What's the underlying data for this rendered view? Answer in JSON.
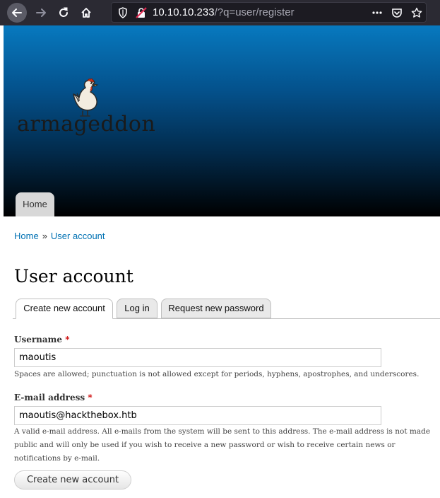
{
  "browser": {
    "url_host": "10.10.10.233",
    "url_path": "/?q=user/register",
    "icons": [
      "back-icon",
      "forward-icon",
      "reload-icon",
      "home-icon",
      "shield-icon",
      "insecure-lock-icon",
      "more-icon",
      "pocket-icon",
      "star-icon"
    ]
  },
  "header": {
    "site_name": "armageddon",
    "nav": {
      "home_label": "Home"
    }
  },
  "breadcrumb": [
    {
      "label": "Home"
    },
    {
      "label": "User account"
    }
  ],
  "breadcrumb_separator": "»",
  "page": {
    "title": "User account",
    "tabs": [
      {
        "label": "Create new account",
        "active": true
      },
      {
        "label": "Log in",
        "active": false
      },
      {
        "label": "Request new password",
        "active": false
      }
    ]
  },
  "form": {
    "username": {
      "label": "Username",
      "required_marker": "*",
      "value": "maoutis",
      "description": "Spaces are allowed; punctuation is not allowed except for periods, hyphens, apostrophes, and underscores."
    },
    "email": {
      "label": "E-mail address",
      "required_marker": "*",
      "value": "maoutis@hackthebox.htb",
      "description": "A valid e-mail address. All e-mails from the system will be sent to this address. The e-mail address is not made public and will only be used if you wish to receive a new password or wish to receive certain news or notifications by e-mail."
    },
    "submit_label": "Create new account"
  },
  "colors": {
    "link": "#0071b3",
    "required": "#cc0000",
    "header_top": "#0779bf",
    "header_bottom": "#000000"
  }
}
